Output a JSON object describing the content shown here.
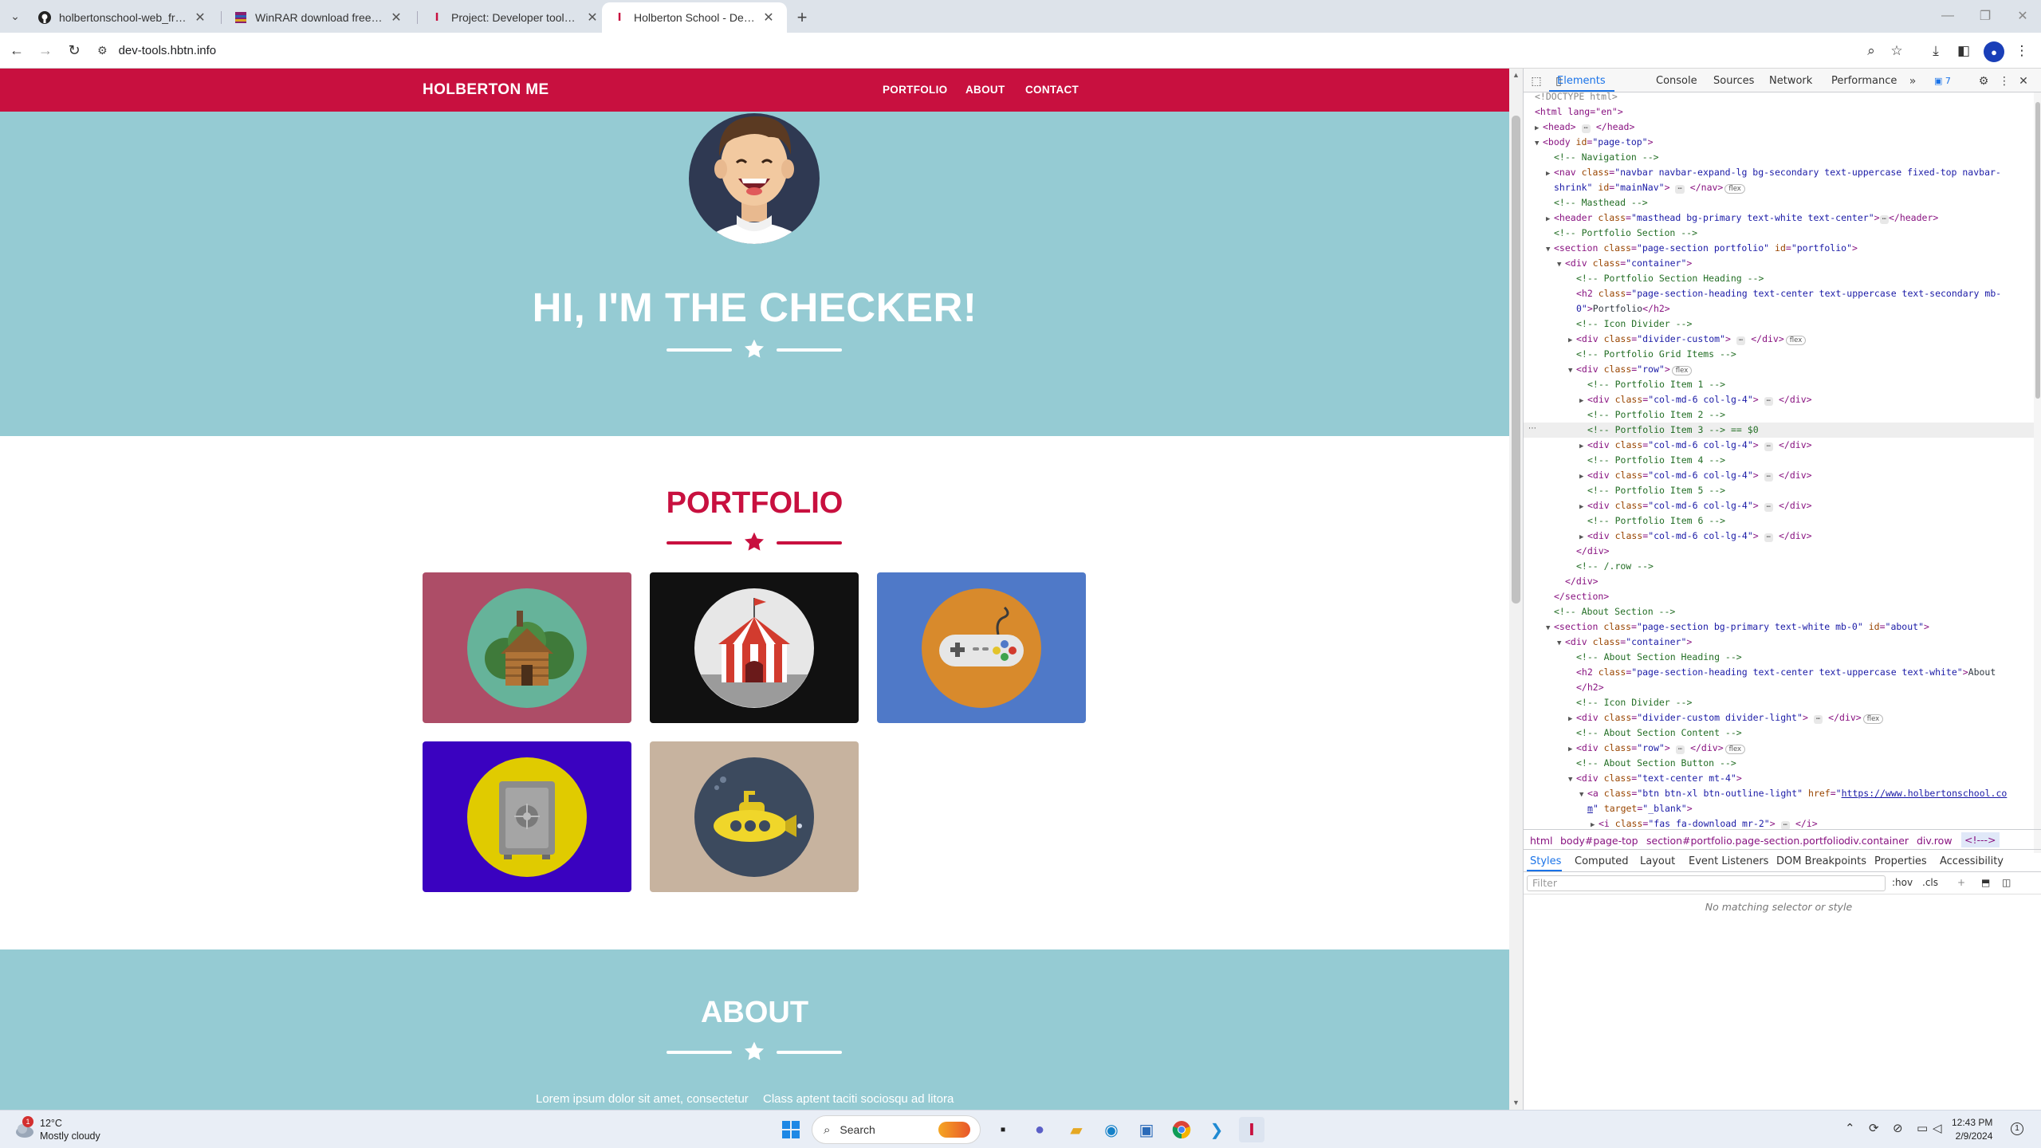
{
  "browser": {
    "tabs": [
      {
        "title": "holbertonschool-web_front_end",
        "icon": "github-icon"
      },
      {
        "title": "WinRAR download free and support",
        "icon": "winrar-icon"
      },
      {
        "title": "Project: Developer tools | Holberton",
        "icon": "holberton-icon"
      },
      {
        "title": "Holberton School - Developer tools",
        "icon": "holberton-icon",
        "active": true
      }
    ],
    "url": "dev-tools.hbtn.info"
  },
  "site": {
    "brand": "HOLBERTON ME",
    "nav": [
      "PORTFOLIO",
      "ABOUT",
      "CONTACT"
    ],
    "hero_title": "HI, I'M THE CHECKER!",
    "portfolio_title": "PORTFOLIO",
    "portfolio_items": [
      {
        "name": "cabin",
        "bg": "#ad4d67"
      },
      {
        "name": "circus-tent",
        "bg": "#111111"
      },
      {
        "name": "game-controller",
        "bg": "#4f79c8"
      },
      {
        "name": "safe",
        "bg": "#3a02c0"
      },
      {
        "name": "submarine",
        "bg": "#c7b39f"
      }
    ],
    "about_title": "ABOUT",
    "about_left": "Lorem ipsum dolor sit amet, consectetur",
    "about_right": "Class aptent taciti sociosqu ad litora",
    "colors": {
      "primary": "#c8103f",
      "masthead": "#95cbd3"
    }
  },
  "devtools": {
    "tabs": [
      "Elements",
      "Console",
      "Sources",
      "Network",
      "Performance"
    ],
    "issues_count": "7",
    "dom": {
      "doctype": "<!DOCTYPE html>",
      "html_open": "<html lang=\"en\">",
      "head": "head",
      "body_id": "page-top",
      "c_navigation": "<!-- Navigation -->",
      "nav_class1": "navbar navbar-expand-lg bg-secondary text-uppercase fixed-top navbar-",
      "nav_class2": "shrink",
      "nav_id": "mainNav",
      "c_masthead": "<!-- Masthead -->",
      "header_class": "masthead bg-primary text-white text-center",
      "c_portfolio_section": "<!-- Portfolio Section -->",
      "section_class": "page-section portfolio",
      "section_id": "portfolio",
      "container_class": "container",
      "c_portfolio_heading": "<!-- Portfolio Section Heading -->",
      "h2_class1": "page-section-heading text-center text-uppercase text-secondary mb-",
      "h2_text": "Portfolio",
      "c_icon_divider": "<!-- Icon Divider -->",
      "divider_class": "divider-custom",
      "c_grid_items": "<!-- Portfolio Grid Items -->",
      "row_class": "row",
      "c_item1": "<!-- Portfolio Item 1 -->",
      "col_class": "col-md-6 col-lg-4",
      "c_item2": "<!-- Portfolio Item 2 -->",
      "c_item3": "<!-- Portfolio Item 3 --> == $0",
      "c_item4": "<!-- Portfolio Item 4 -->",
      "c_item5": "<!-- Portfolio Item 5 -->",
      "c_item6": "<!-- Portfolio Item 6 -->",
      "c_row_end": "<!-- /.row -->",
      "c_about_section": "<!-- About Section -->",
      "about_section_class": "page-section bg-primary text-white mb-0",
      "about_section_id": "about",
      "c_about_heading": "<!-- About Section Heading -->",
      "about_h2_class": "page-section-heading text-center text-uppercase text-white",
      "about_h2_text": "About",
      "divider_light_class": "divider-custom divider-light",
      "c_about_content": "<!-- About Section Content -->",
      "c_about_button": "<!-- About Section Button -->",
      "text_center_class": "text-center mt-4",
      "a_class": "btn btn-xl btn-outline-light",
      "a_href1": "https://www.holbertonschool.co",
      "a_href2": "m",
      "a_target": "_blank",
      "i_class": "fas fa-download mr-2"
    },
    "breadcrumbs": [
      "html",
      "body#page-top",
      "section#portfolio.page-section.portfolio",
      "div.container",
      "div.row",
      "<!--->"
    ],
    "subtabs": [
      "Styles",
      "Computed",
      "Layout",
      "Event Listeners",
      "DOM Breakpoints",
      "Properties",
      "Accessibility"
    ],
    "filter_placeholder": "Filter",
    "hov": ":hov",
    "cls": ".cls",
    "no_match": "No matching selector or style"
  },
  "taskbar": {
    "temp": "12°C",
    "weather": "Mostly cloudy",
    "weather_badge": "1",
    "search": "Search",
    "time": "12:43 PM",
    "date": "2/9/2024",
    "notif": "1"
  }
}
